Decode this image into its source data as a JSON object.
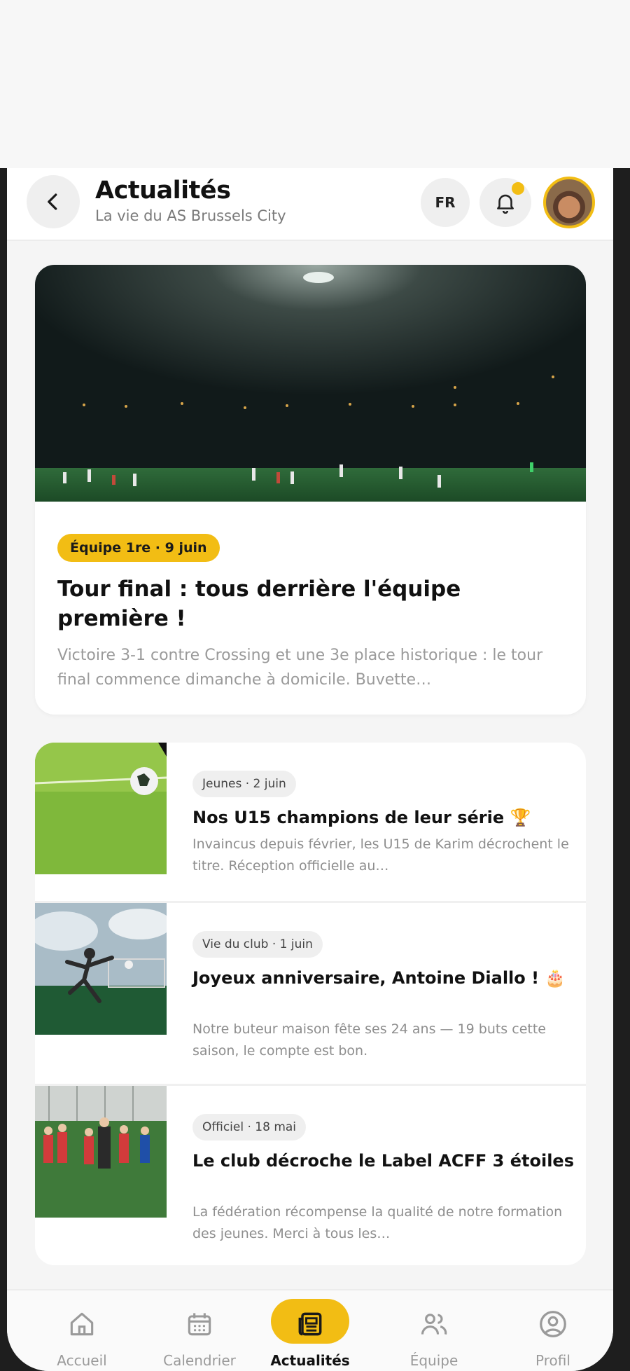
{
  "header": {
    "title": "Actualités",
    "subtitle": "La vie du AS Brussels City",
    "language": "FR",
    "back_icon": "chevron-left-icon",
    "notification_icon": "bell-icon",
    "accent_color": "#f2bd14"
  },
  "featured": {
    "tag": "Équipe 1re · 9 juin",
    "title": "Tour final : tous derrière l'équipe première !",
    "excerpt": "Victoire 3-1 contre Crossing et une 3e place historique : le tour final commence dimanche à domicile. Buvette…"
  },
  "news": [
    {
      "tag": "Jeunes · 2 juin",
      "title": "Nos U15 champions de leur série 🏆",
      "excerpt": "Invaincus depuis février, les U15 de Karim décrochent le titre. Réception officielle au…"
    },
    {
      "tag": "Vie du club · 1 juin",
      "title": "Joyeux anniversaire, Antoine Diallo ! 🎂",
      "excerpt": "Notre buteur maison fête ses 24 ans — 19 buts cette saison, le compte est bon."
    },
    {
      "tag": "Officiel · 18 mai",
      "title": "Le club décroche le Label ACFF 3 étoiles",
      "excerpt": "La fédération récompense la qualité de notre formation des jeunes. Merci à tous les…"
    }
  ],
  "nav": [
    {
      "label": "Accueil",
      "icon": "home-icon"
    },
    {
      "label": "Calendrier",
      "icon": "calendar-icon"
    },
    {
      "label": "Actualités",
      "icon": "news-icon",
      "active": true
    },
    {
      "label": "Équipe",
      "icon": "team-icon"
    },
    {
      "label": "Profil",
      "icon": "profile-icon"
    }
  ]
}
